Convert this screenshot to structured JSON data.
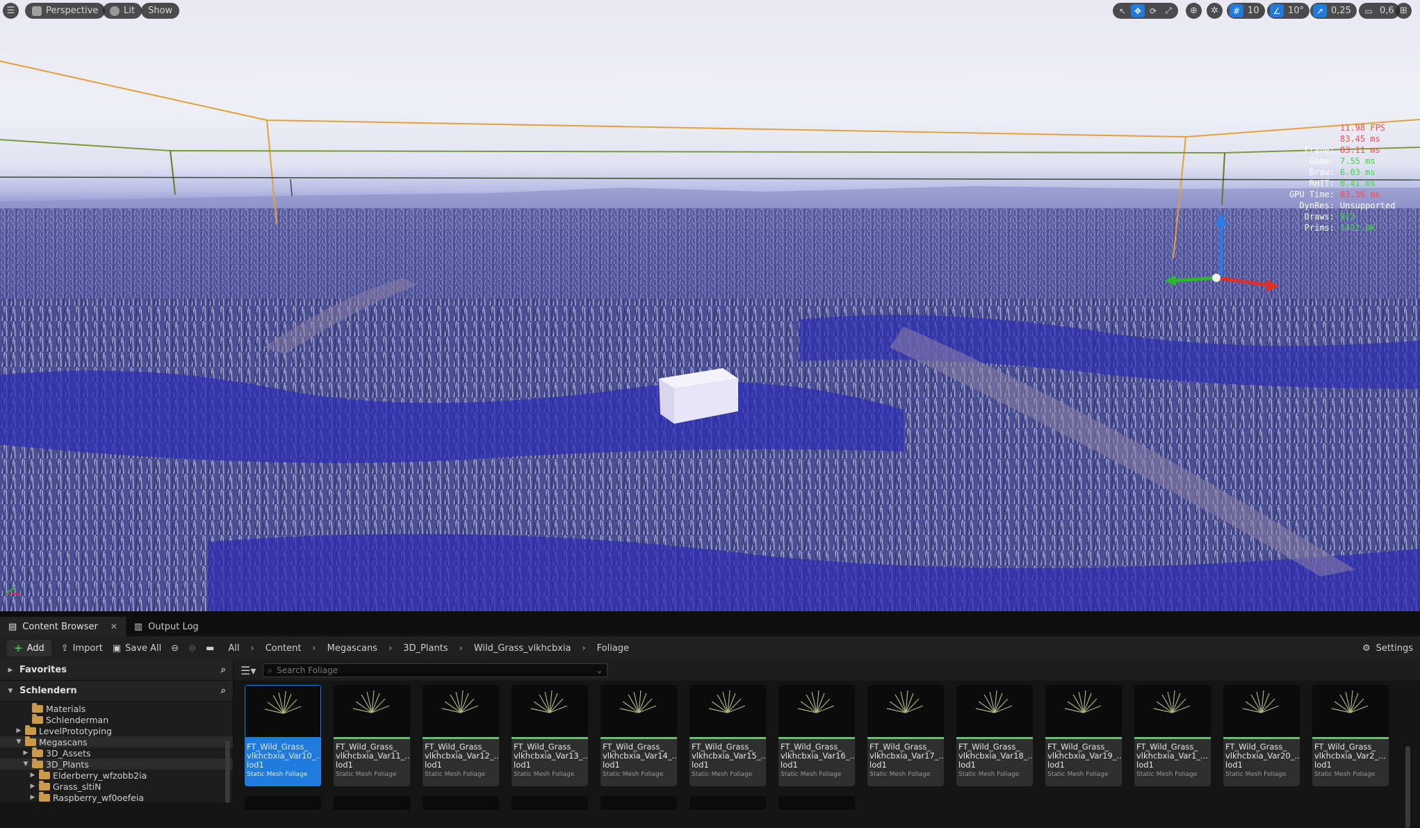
{
  "viewport": {
    "menu_icon": "hamburger-icon",
    "perspective_label": "Perspective",
    "lit_label": "Lit",
    "show_label": "Show",
    "grid_snap_value": "10",
    "rotation_snap_value": "10°",
    "scale_snap_value": "0,25",
    "camera_speed_value": "0,6"
  },
  "stats": {
    "fps": "11.98 FPS",
    "ms": "83.45 ms",
    "rows": [
      {
        "label": "Frame:",
        "value": "83.11 ms",
        "color": "red"
      },
      {
        "label": "Game:",
        "value": "7.55 ms",
        "color": "green"
      },
      {
        "label": "Draw:",
        "value": "6.03 ms",
        "color": "green"
      },
      {
        "label": "RHIT:",
        "value": "8.41 ms",
        "color": "green"
      },
      {
        "label": "GPU Time:",
        "value": "83.36 ms",
        "color": "red"
      },
      {
        "label": "DynRes:",
        "value": "Unsupported",
        "color": "white"
      },
      {
        "label": "Draws:",
        "value": "813",
        "color": "green"
      },
      {
        "label": "Prims:",
        "value": "1422.0K",
        "color": "green"
      }
    ]
  },
  "tabs": {
    "content_browser": "Content Browser",
    "output_log": "Output Log"
  },
  "toolbar": {
    "add_label": "Add",
    "import_label": "Import",
    "save_all_label": "Save All",
    "settings_label": "Settings",
    "breadcrumbs": [
      "All",
      "Content",
      "Megascans",
      "3D_Plants",
      "Wild_Grass_vlkhcbxia",
      "Foliage"
    ]
  },
  "sidebar": {
    "favorites_label": "Favorites",
    "project_label": "Schlendern",
    "tree": [
      {
        "label": "Materials",
        "indent": 3,
        "arrow": ""
      },
      {
        "label": "Schlenderman",
        "indent": 3,
        "arrow": ""
      },
      {
        "label": "LevelPrototyping",
        "indent": 2,
        "arrow": "▶"
      },
      {
        "label": "Megascans",
        "indent": 2,
        "arrow": "▼",
        "selected": true
      },
      {
        "label": "3D_Assets",
        "indent": 3,
        "arrow": "▶"
      },
      {
        "label": "3D_Plants",
        "indent": 3,
        "arrow": "▼",
        "selected": true
      },
      {
        "label": "Elderberry_wfzobb2ia",
        "indent": 4,
        "arrow": "▶"
      },
      {
        "label": "Grass_sltiN",
        "indent": 4,
        "arrow": "▶"
      },
      {
        "label": "Raspberry_wf0oefeia",
        "indent": 4,
        "arrow": "▶"
      }
    ]
  },
  "search": {
    "placeholder": "Search Foliage"
  },
  "assets": {
    "type_label": "Static Mesh Foliage",
    "items": [
      {
        "name": "FT_Wild_Grass_\nvlkhcbxia_Var10_...\nlod1",
        "selected": true
      },
      {
        "name": "FT_Wild_Grass_\nvlkhcbxia_Var11_...\nlod1"
      },
      {
        "name": "FT_Wild_Grass_\nvlkhcbxia_Var12_...\nlod1"
      },
      {
        "name": "FT_Wild_Grass_\nvlkhcbxia_Var13_...\nlod1"
      },
      {
        "name": "FT_Wild_Grass_\nvlkhcbxia_Var14_...\nlod1"
      },
      {
        "name": "FT_Wild_Grass_\nvlkhcbxia_Var15_...\nlod1"
      },
      {
        "name": "FT_Wild_Grass_\nvlkhcbxia_Var16_...\nlod1"
      },
      {
        "name": "FT_Wild_Grass_\nvlkhcbxia_Var17_...\nlod1"
      },
      {
        "name": "FT_Wild_Grass_\nvlkhcbxia_Var18_...\nlod1"
      },
      {
        "name": "FT_Wild_Grass_\nvlkhcbxia_Var19_...\nlod1"
      },
      {
        "name": "FT_Wild_Grass_\nvlkhcbxia_Var1_...\nlod1"
      },
      {
        "name": "FT_Wild_Grass_\nvlkhcbxia_Var20_...\nlod1"
      },
      {
        "name": "FT_Wild_Grass_\nvlkhcbxia_Var2_...\nlod1"
      }
    ]
  },
  "colors": {
    "accent": "#1f7bdc",
    "asset_type_bar": "#5fc75f",
    "folder": "#c89a4a",
    "stat_red": "#ff4a4a",
    "stat_green": "#3cdc3c"
  }
}
